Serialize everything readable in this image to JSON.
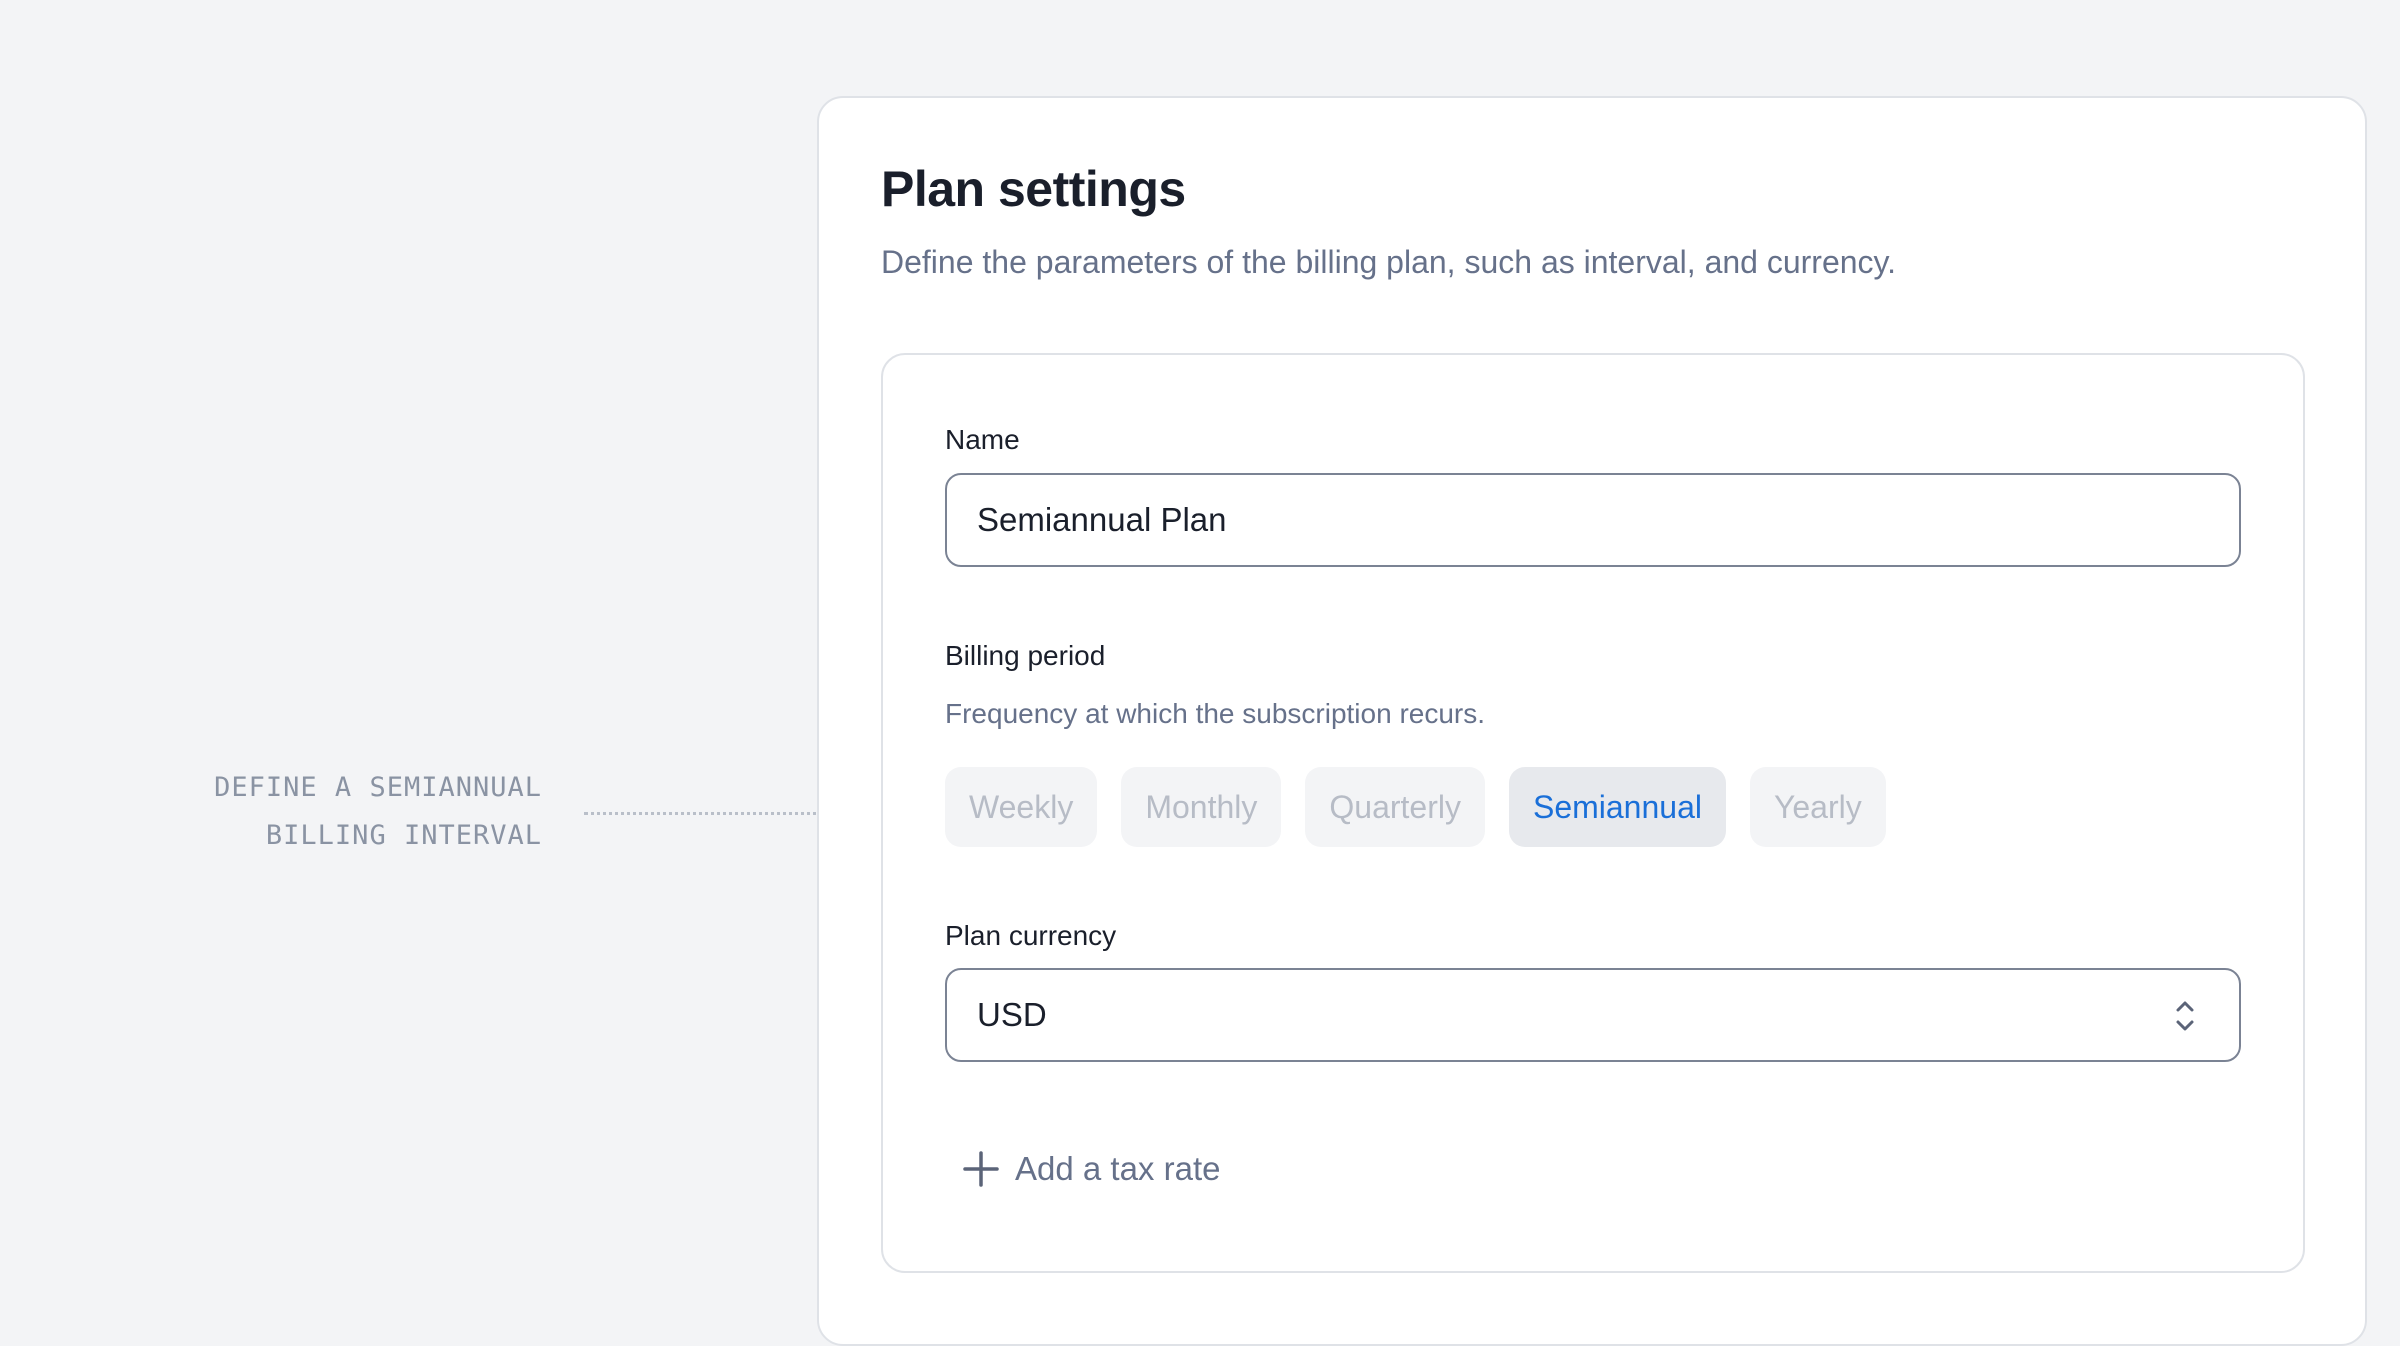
{
  "annotation": {
    "line1": "DEFINE A SEMIANNUAL",
    "line2": "BILLING INTERVAL"
  },
  "card": {
    "title": "Plan settings",
    "description": "Define the parameters of the billing plan, such as interval, and currency."
  },
  "name_field": {
    "label": "Name",
    "value": "Semiannual Plan"
  },
  "billing_period": {
    "label": "Billing period",
    "hint": "Frequency at which the subscription recurs.",
    "options": [
      "Weekly",
      "Monthly",
      "Quarterly",
      "Semiannual",
      "Yearly"
    ],
    "selected": "Semiannual"
  },
  "currency": {
    "label": "Plan currency",
    "value": "USD",
    "icon": "chevron-up-down-icon"
  },
  "tax": {
    "label": "Add a tax rate",
    "icon": "plus-icon"
  },
  "colors": {
    "accent": "#1a6fd8",
    "muted_text": "#66718a",
    "background": "#f3f4f6"
  }
}
